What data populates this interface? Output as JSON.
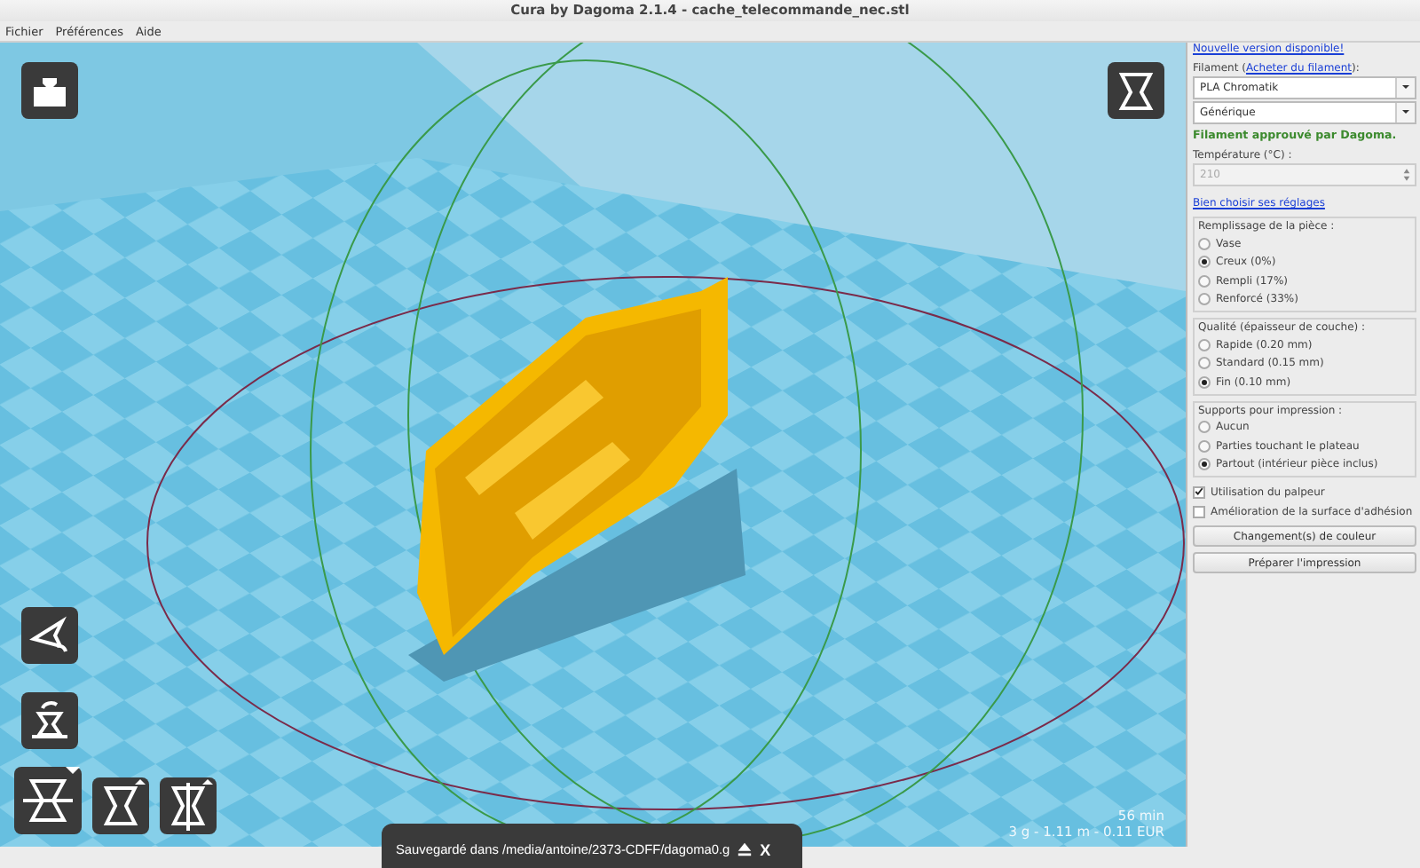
{
  "window": {
    "title": "Cura by Dagoma 2.1.4 - cache_telecommande_nec.stl"
  },
  "menu": [
    "Fichier",
    "Préférences",
    "Aide"
  ],
  "viewport": {
    "estimate": {
      "time": "56 min",
      "material": "3 g - 1.11 m - 0.11 EUR"
    },
    "notification": {
      "text": "Sauvegardé dans /media/antoine/2373-CDFF/dagoma0.g",
      "close": "X"
    }
  },
  "panel": {
    "update_link": "Nouvelle version disponible!",
    "filament_label": {
      "before": "Filament (",
      "link": "Acheter du filament",
      "after": "):"
    },
    "filament": "PLA Chromatik",
    "brand": "Générique",
    "approved": "Filament approuvé par Dagoma.",
    "temperature": {
      "label": "Température (°C) :",
      "value": "210",
      "disabled": true
    },
    "settings_link": "Bien choisir ses réglages",
    "groups": [
      {
        "title": "Remplissage de la pièce :",
        "options": [
          {
            "label": "Vase",
            "selected": false
          },
          {
            "label": "Creux (0%)",
            "selected": true
          },
          {
            "label": "Rempli (17%)",
            "selected": false
          },
          {
            "label": "Renforcé (33%)",
            "selected": false
          }
        ]
      },
      {
        "title": "Qualité (épaisseur de couche) :",
        "options": [
          {
            "label": "Rapide (0.20 mm)",
            "selected": false
          },
          {
            "label": "Standard (0.15 mm)",
            "selected": false
          },
          {
            "label": "Fin (0.10 mm)",
            "selected": true
          }
        ]
      },
      {
        "title": "Supports pour impression :",
        "options": [
          {
            "label": "Aucun",
            "selected": false
          },
          {
            "label": "Parties touchant le plateau",
            "selected": false
          },
          {
            "label": "Partout (intérieur pièce inclus)",
            "selected": true
          }
        ]
      }
    ],
    "checkboxes": [
      {
        "label": "Utilisation du palpeur",
        "checked": true
      },
      {
        "label": "Amélioration de la surface d'adhésion",
        "checked": false
      }
    ],
    "buttons": [
      "Changement(s) de couleur",
      "Préparer l'impression"
    ]
  }
}
